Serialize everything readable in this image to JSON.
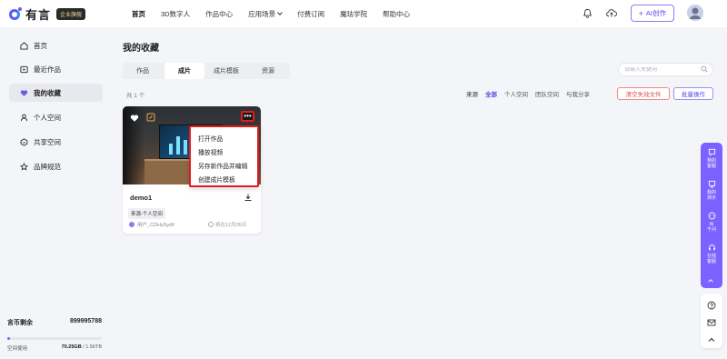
{
  "brand": {
    "name": "有言",
    "badge": "企业旗舰"
  },
  "nav": [
    "首页",
    "3D数字人",
    "作品中心",
    "应用场景",
    "付费订阅",
    "魔珐学院",
    "帮助中心"
  ],
  "ai_button": "AI创作",
  "sidebar": {
    "items": [
      {
        "label": "首页",
        "icon": "home-icon"
      },
      {
        "label": "最近作品",
        "icon": "play-square-icon"
      },
      {
        "label": "我的收藏",
        "icon": "heart-icon"
      },
      {
        "label": "个人空间",
        "icon": "user-icon"
      },
      {
        "label": "共享空间",
        "icon": "share-space-icon"
      },
      {
        "label": "品牌规范",
        "icon": "brand-icon"
      }
    ],
    "active_index": 2,
    "credits_label": "言币剩余",
    "credits_value": "899995788",
    "storage_label": "空间使用",
    "storage_used": "70.25GB",
    "storage_total": "/ 1.56TB",
    "storage_fraction": 0.03
  },
  "page_title": "我的收藏",
  "tabs": [
    "作品",
    "成片",
    "成片模板",
    "资源"
  ],
  "active_tab": 1,
  "search": {
    "placeholder": "请输入关键词"
  },
  "count_text": "共 1 个",
  "filters": {
    "label": "来源",
    "options": [
      "全部",
      "个人空间",
      "团队空间",
      "与我分享"
    ],
    "selected": 0
  },
  "buttons": {
    "clear": "清空失效文件",
    "batch": "批量操作"
  },
  "card": {
    "title": "demo1",
    "source_tag": "来源-个人空间",
    "user": "用户_CDHySydF",
    "expire": "将在12月05日",
    "more": "•••"
  },
  "menu": [
    "打开作品",
    "播放视频",
    "另存新作品并编辑",
    "创建成片模板"
  ],
  "float": [
    {
      "label1": "我的",
      "label2": "客服",
      "icon": "service-icon"
    },
    {
      "label1": "我的",
      "label2": "演示",
      "icon": "present-icon"
    },
    {
      "label1": "AI",
      "label2": "千问",
      "icon": "ai-chat-icon"
    },
    {
      "label1": "在线",
      "label2": "客服",
      "icon": "headset-icon"
    }
  ],
  "colors": {
    "accent": "#7b61ff",
    "danger": "#e14c4c",
    "highlight": "#e21b1b"
  }
}
